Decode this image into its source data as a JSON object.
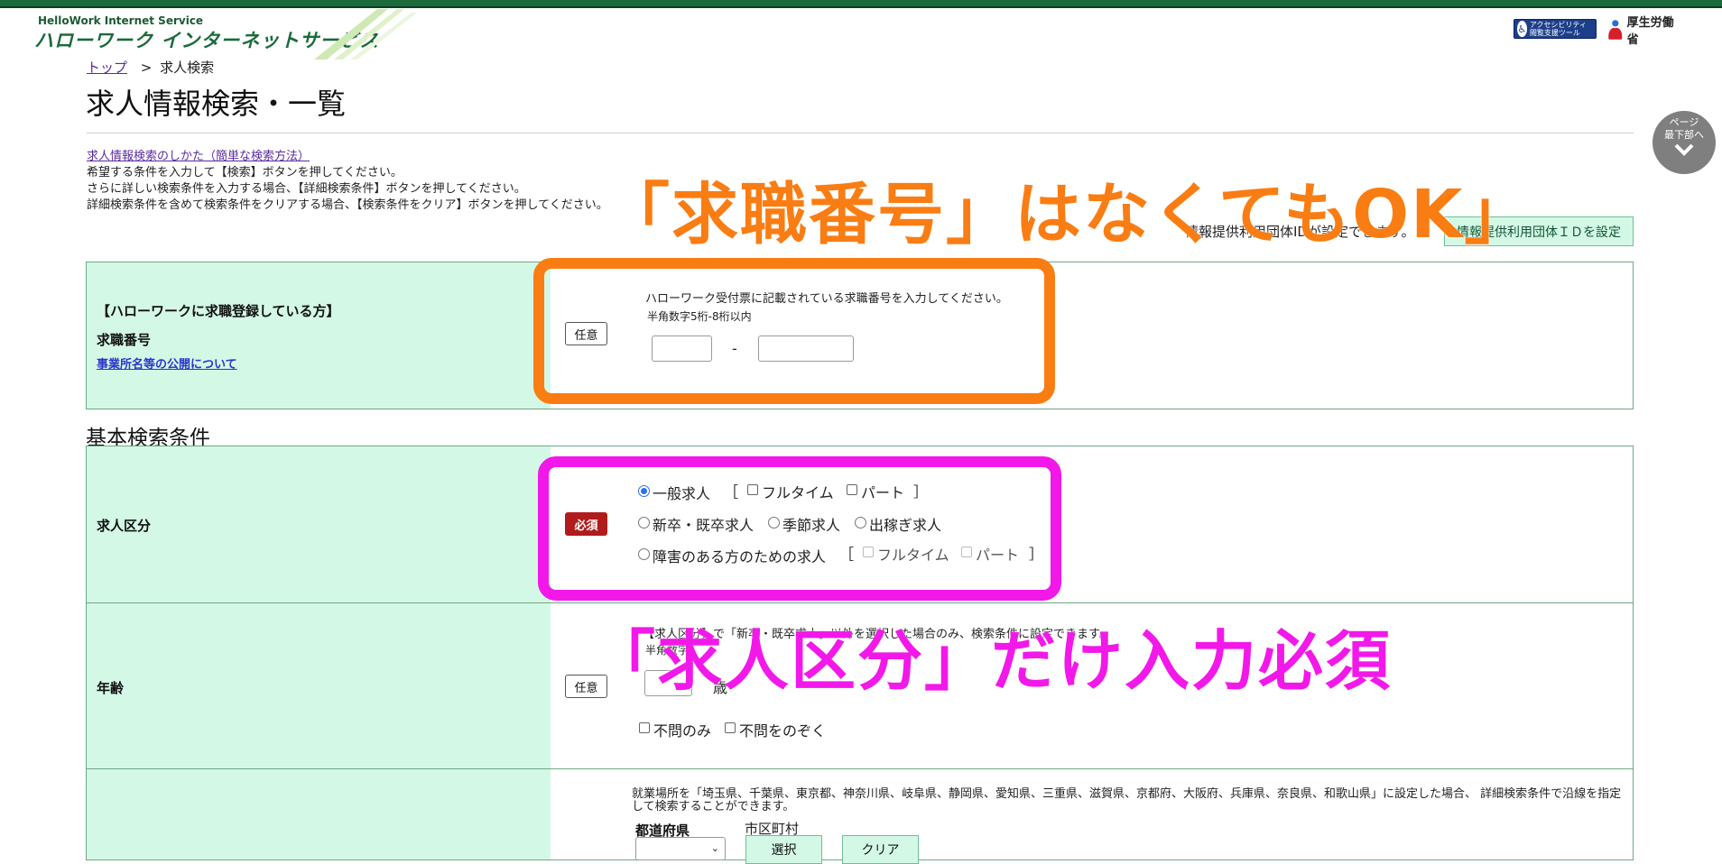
{
  "header": {
    "logo_en": "HelloWork Internet Service",
    "logo_jp": "ハローワーク インターネットサービス",
    "access_tool_label": "アクセシビリティ 閲覧支援ツール",
    "mhlw_label": "厚生労働省"
  },
  "breadcrumb": {
    "top_link": "トップ",
    "separator": ">",
    "current": "求人検索"
  },
  "page_title": "求人情報検索・一覧",
  "page_down_button": "ページ 最下部へ",
  "intro": {
    "howto_link": "求人情報検索のしかた（簡単な検索方法）",
    "lines": [
      "希望する条件を入力して【検索】ボタンを押してください。",
      "さらに詳しい検索条件を入力する場合、【詳細検索条件】ボタンを押してください。",
      "詳細検索条件を含めて検索条件をクリアする場合、【検索条件をクリア】ボタンを押してください。"
    ],
    "info_text": "情報提供利用団体IDが設定できます。",
    "info_button": "情報提供利用団体ＩＤを設定"
  },
  "job_seeker_number": {
    "section_label": "【ハローワークに求職登録している方】",
    "field_label": "求職番号",
    "disclosure_link": "事業所名等の公開について",
    "badge": "任意",
    "help": "ハローワーク受付票に記載されている求職番号を入力してください。",
    "constraint": "半角数字5桁-8桁以内",
    "dash": "-",
    "value_1": "",
    "value_2": ""
  },
  "basic_conditions_heading": "基本検索条件",
  "job_category": {
    "label": "求人区分",
    "badge": "必須",
    "general": "一般求人",
    "bracket_open": "［",
    "bracket_close": "］",
    "fulltime": "フルタイム",
    "parttime": "パート",
    "new_grad": "新卒・既卒求人",
    "seasonal": "季節求人",
    "migrant": "出稼ぎ求人",
    "disability": "障害のある方のための求人",
    "disability_fulltime": "フルタイム",
    "disability_parttime": "パート",
    "selected": "一般求人"
  },
  "age": {
    "label": "年齢",
    "badge": "任意",
    "note": "【求人区分】で「新卒・既卒求人」以外を選択した場合のみ、検索条件に設定できます。",
    "constraint": "半角数字",
    "unit": "歳",
    "value": "",
    "no_age_only": "不問のみ",
    "exclude_no_age": "不問をのぞく"
  },
  "workplace": {
    "note": "就業場所を「埼玉県、千葉県、東京都、神奈川県、岐阜県、静岡県、愛知県、三重県、滋賀県、京都府、大阪府、兵庫県、奈良県、和歌山県」に設定した場合、 詳細検索条件で沿線を指定して検索することができます。",
    "prefecture_label": "都道府県",
    "city_label": "市区町村",
    "prefecture_value": "",
    "select_button": "選択",
    "clear_button": "クリア"
  },
  "annotations": {
    "orange_text": "「求職番号」はなくてもOK」",
    "magenta_text": "「求人区分」だけ入力必須",
    "orange_color": "#fa7d13",
    "magenta_color": "#f318ea"
  }
}
